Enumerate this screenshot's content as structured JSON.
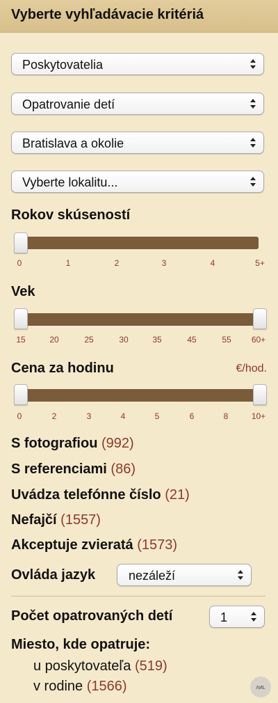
{
  "header": {
    "title": "Vyberte vyhľadávacie kritériá"
  },
  "selects": [
    {
      "value": "Poskytovatelia"
    },
    {
      "value": "Opatrovanie detí"
    },
    {
      "value": "Bratislava a okolie"
    },
    {
      "value": "Vyberte lokalitu..."
    }
  ],
  "experience": {
    "title": "Rokov skúseností",
    "ticks": [
      "0",
      "1",
      "2",
      "3",
      "4",
      "5+"
    ],
    "selected_min": "0"
  },
  "age": {
    "title": "Vek",
    "ticks": [
      "15",
      "20",
      "25",
      "30",
      "35",
      "45",
      "55",
      "60+"
    ],
    "selected_min": "15",
    "selected_max": "60+"
  },
  "price": {
    "title": "Cena za hodinu",
    "unit": "€/hod.",
    "ticks": [
      "0",
      "2",
      "3",
      "4",
      "5",
      "6",
      "8",
      "10+"
    ],
    "selected_min": "0",
    "selected_max": "10+"
  },
  "filters": [
    {
      "label": "S fotografiou",
      "count": "(992)"
    },
    {
      "label": "S referenciami",
      "count": "(86)"
    },
    {
      "label": "Uvádza telefónne číslo",
      "count": "(21)"
    },
    {
      "label": "Nefajčí",
      "count": "(1557)"
    },
    {
      "label": "Akceptuje zvieratá",
      "count": "(1573)"
    }
  ],
  "language": {
    "label": "Ovláda jazyk",
    "value": "nezáleží"
  },
  "children": {
    "label": "Počet opatrovaných detí",
    "value": "1"
  },
  "place": {
    "label": "Miesto, kde opatruje:",
    "options": [
      {
        "label": "u poskytovateľa",
        "count": "(519)"
      },
      {
        "label": "v rodine",
        "count": "(1566)"
      }
    ]
  },
  "badge": {
    "text": "ᴧᴎʟ"
  },
  "colors": {
    "background": "#f5e9cc",
    "header": "#dcc591",
    "track": "#7a5b3a",
    "accent_text": "#8b3a2a"
  }
}
